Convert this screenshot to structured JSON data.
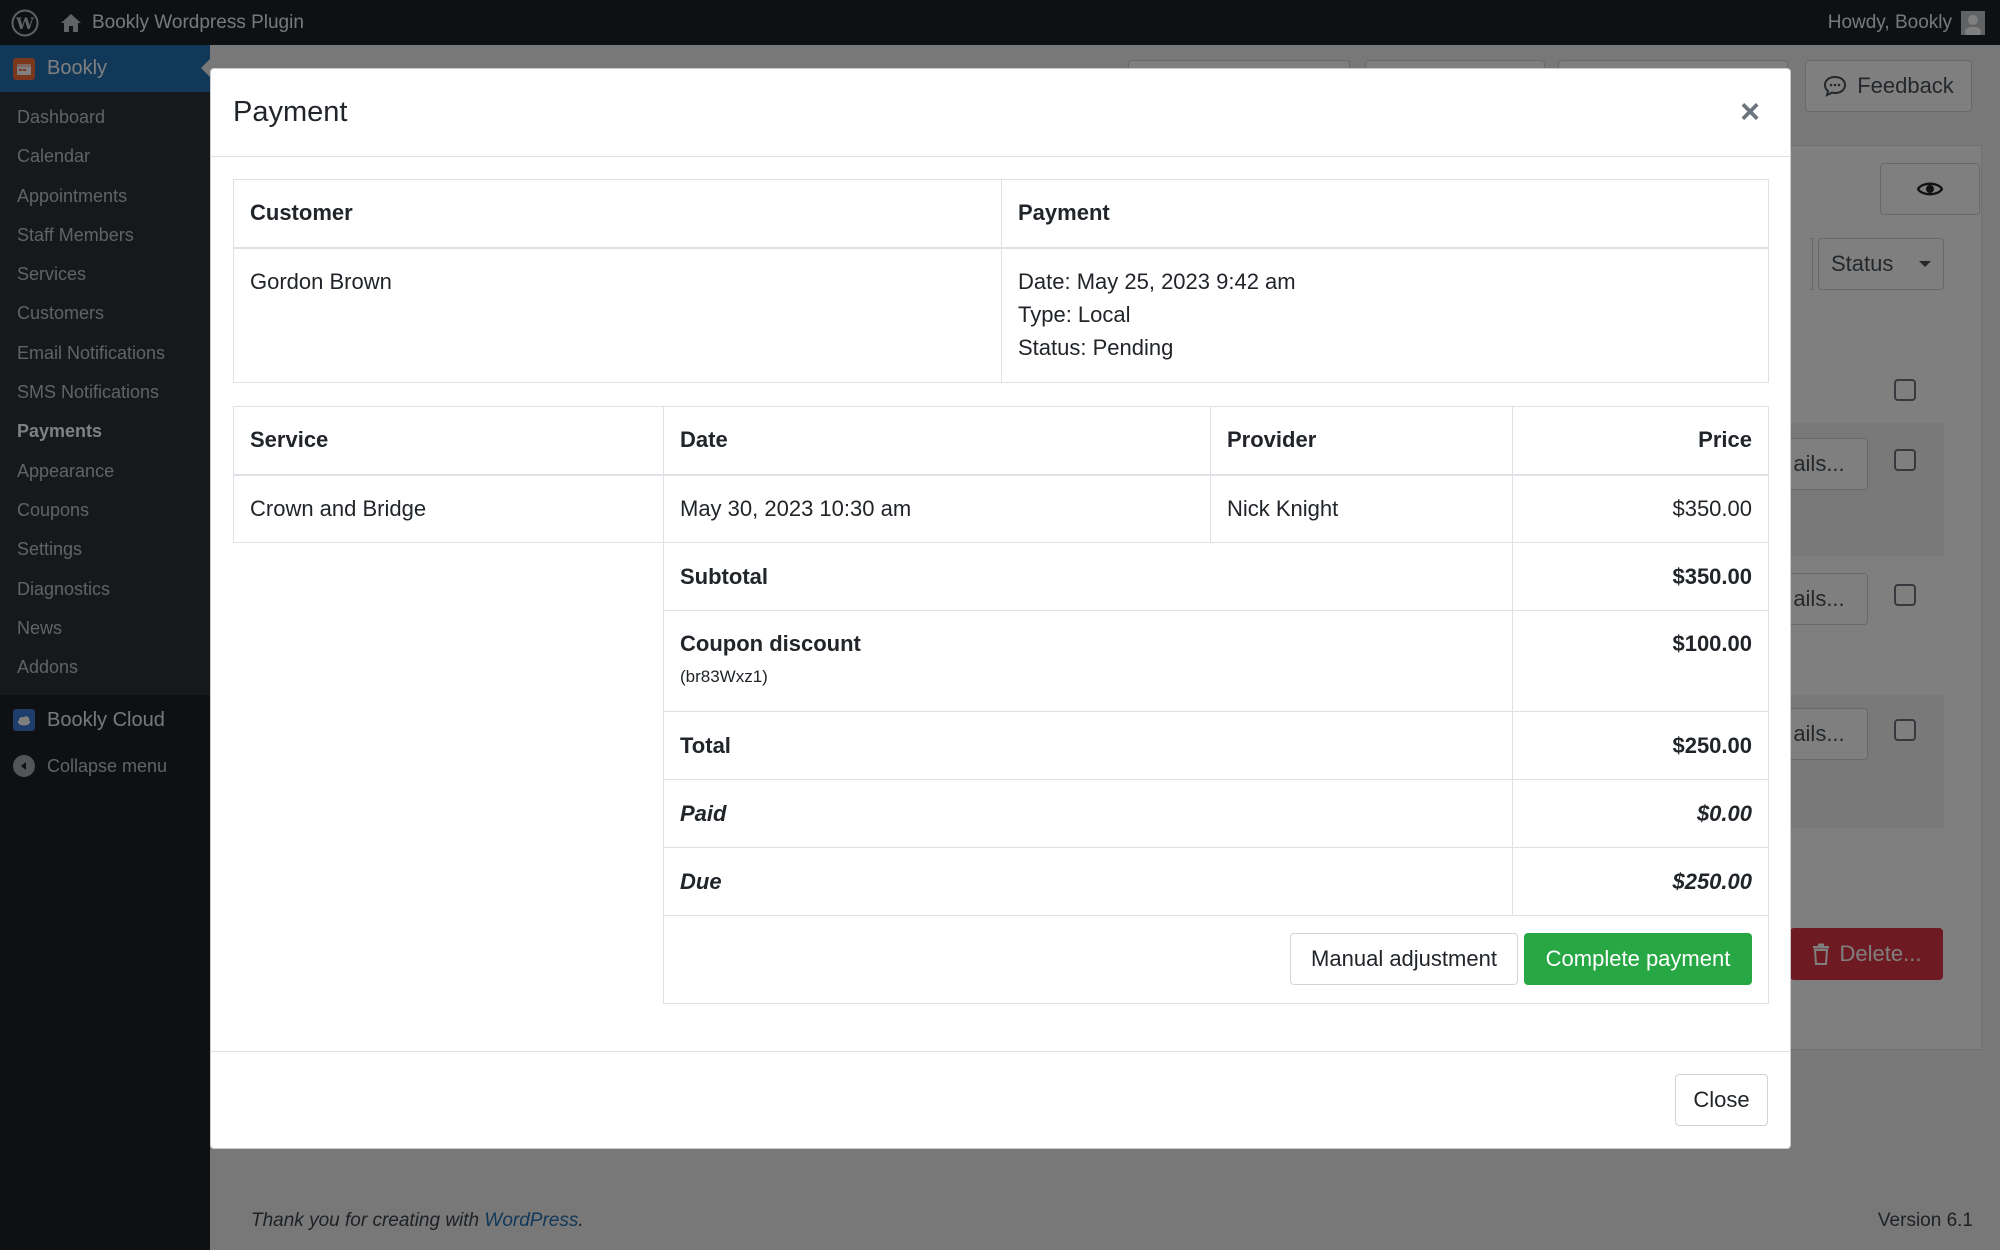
{
  "admin_bar": {
    "site_name": "Bookly Wordpress Plugin",
    "howdy": "Howdy, Bookly"
  },
  "sidebar": {
    "plugin_title": "Bookly",
    "items": [
      {
        "label": "Dashboard"
      },
      {
        "label": "Calendar"
      },
      {
        "label": "Appointments"
      },
      {
        "label": "Staff Members"
      },
      {
        "label": "Services"
      },
      {
        "label": "Customers"
      },
      {
        "label": "Email Notifications"
      },
      {
        "label": "SMS Notifications"
      },
      {
        "label": "Payments"
      },
      {
        "label": "Appearance"
      },
      {
        "label": "Coupons"
      },
      {
        "label": "Settings"
      },
      {
        "label": "Diagnostics"
      },
      {
        "label": "News"
      },
      {
        "label": "Addons"
      }
    ],
    "active_item": "Payments",
    "cloud": "Bookly Cloud",
    "collapse": "Collapse menu"
  },
  "background": {
    "feedback": "Feedback",
    "status_select": "Status",
    "details_label": "ails...",
    "delete_label": "Delete..."
  },
  "modal": {
    "title": "Payment",
    "close_symbol": "×",
    "info_table": {
      "customer_header": "Customer",
      "payment_header": "Payment",
      "customer_name": "Gordon Brown",
      "date": "Date: May 25, 2023 9:42 am",
      "type": "Type: Local",
      "status": "Status: Pending"
    },
    "items_table": {
      "headers": {
        "service": "Service",
        "date": "Date",
        "provider": "Provider",
        "price": "Price"
      },
      "row": {
        "service": "Crown and Bridge",
        "date": "May 30, 2023 10:30 am",
        "provider": "Nick Knight",
        "price": "$350.00"
      },
      "subtotal_label": "Subtotal",
      "subtotal_value": "$350.00",
      "coupon_label": "Coupon discount",
      "coupon_code": "(br83Wxz1)",
      "coupon_value": "$100.00",
      "total_label": "Total",
      "total_value": "$250.00",
      "paid_label": "Paid",
      "paid_value": "$0.00",
      "due_label": "Due",
      "due_value": "$250.00"
    },
    "manual_adjustment": "Manual adjustment",
    "complete_payment": "Complete payment",
    "close_button": "Close"
  },
  "footer": {
    "thanks_prefix": "Thank you for creating with ",
    "wordpress_link": "WordPress",
    "thanks_suffix": ".",
    "version": "Version 6.1"
  },
  "colors": {
    "admin_dark": "#1d2327",
    "wp_blue": "#2271b1",
    "success": "#28a745",
    "danger": "#dc3545"
  }
}
